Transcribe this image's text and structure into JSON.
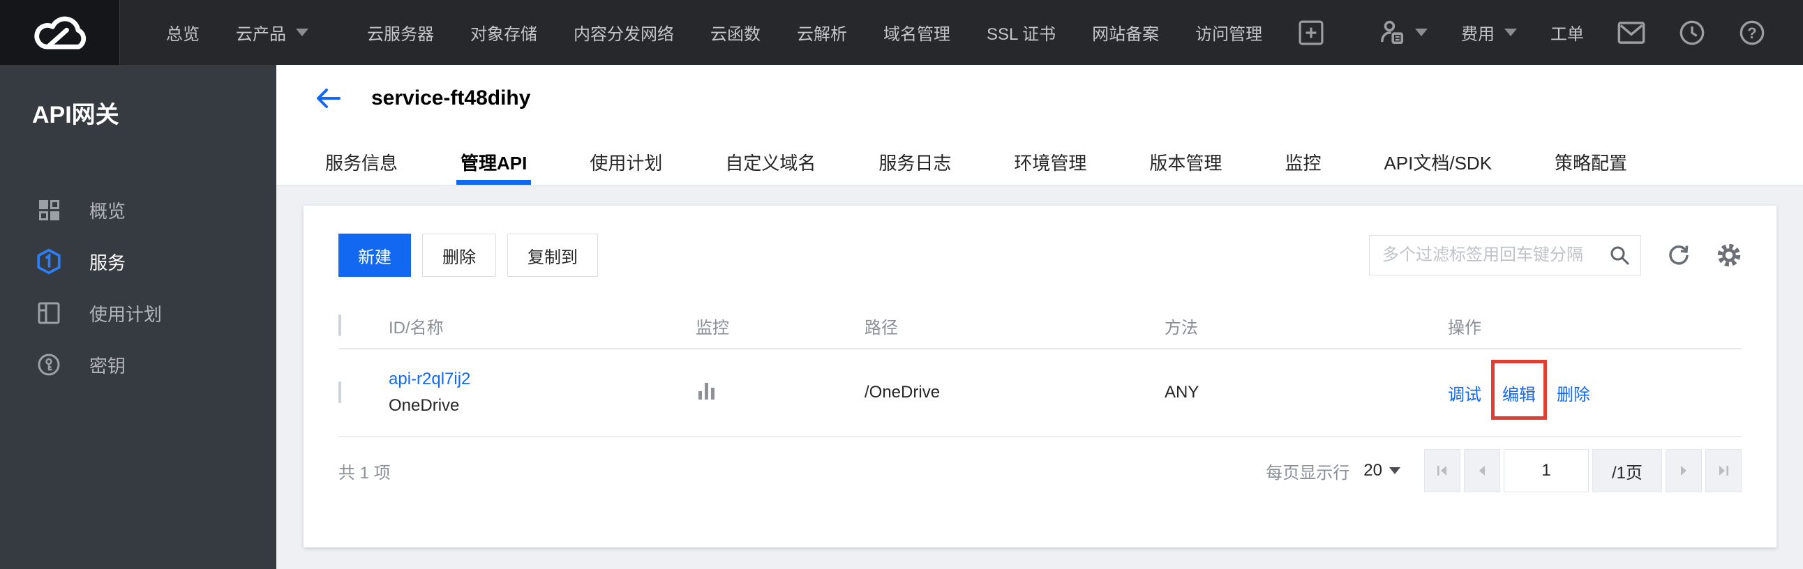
{
  "colors": {
    "accent_blue": "#1268f0",
    "topbar_bg": "#26282c",
    "sidebar_bg": "#363b41",
    "content_bg": "#eef0f3",
    "annotation_red": "#e23d32"
  },
  "topbar": {
    "logo_icon": "tencent-cloud-logo",
    "items": [
      {
        "label": "总览"
      },
      {
        "label": "云产品",
        "caret": true
      },
      {
        "label": "云服务器"
      },
      {
        "label": "对象存储"
      },
      {
        "label": "内容分发网络"
      },
      {
        "label": "云函数"
      },
      {
        "label": "云解析"
      },
      {
        "label": "域名管理"
      },
      {
        "label": "SSL 证书"
      },
      {
        "label": "网站备案"
      },
      {
        "label": "访问管理"
      }
    ],
    "add_icon": "add-product-icon",
    "right": {
      "user_icon": "user-icon",
      "billing_label": "费用",
      "ticket_label": "工单",
      "mail_icon": "mail-icon",
      "history_icon": "clock-icon",
      "help_icon": "help-icon"
    }
  },
  "sidebar": {
    "title": "API网关",
    "items": [
      {
        "label": "概览",
        "icon": "overview-grid-icon"
      },
      {
        "label": "服务",
        "icon": "service-hexagon-icon",
        "active": true
      },
      {
        "label": "使用计划",
        "icon": "usage-plan-icon"
      },
      {
        "label": "密钥",
        "icon": "key-icon"
      }
    ]
  },
  "page": {
    "back_icon": "back-arrow-icon",
    "title": "service-ft48dihy",
    "tabs": [
      {
        "label": "服务信息"
      },
      {
        "label": "管理API",
        "active": true
      },
      {
        "label": "使用计划"
      },
      {
        "label": "自定义域名"
      },
      {
        "label": "服务日志"
      },
      {
        "label": "环境管理"
      },
      {
        "label": "版本管理"
      },
      {
        "label": "监控"
      },
      {
        "label": "API文档/SDK"
      },
      {
        "label": "策略配置"
      }
    ]
  },
  "toolbar": {
    "new_label": "新建",
    "delete_label": "删除",
    "copy_label": "复制到",
    "search_placeholder": "多个过滤标签用回车键分隔",
    "search_icon": "search-icon",
    "refresh_icon": "refresh-icon",
    "settings_icon": "gear-icon"
  },
  "table": {
    "columns": [
      "ID/名称",
      "监控",
      "路径",
      "方法",
      "操作"
    ],
    "rows": [
      {
        "id": "api-r2ql7ij2",
        "name": "OneDrive",
        "monitor_icon": "bar-chart-icon",
        "path": "/OneDrive",
        "method": "ANY",
        "actions": [
          {
            "label": "调试"
          },
          {
            "label": "编辑",
            "highlighted": true
          },
          {
            "label": "删除"
          }
        ]
      }
    ]
  },
  "footer": {
    "total_text": "共 1 项",
    "per_page_label": "每页显示行",
    "per_page_value": "20",
    "page_value": "1",
    "page_total": "/1页"
  }
}
